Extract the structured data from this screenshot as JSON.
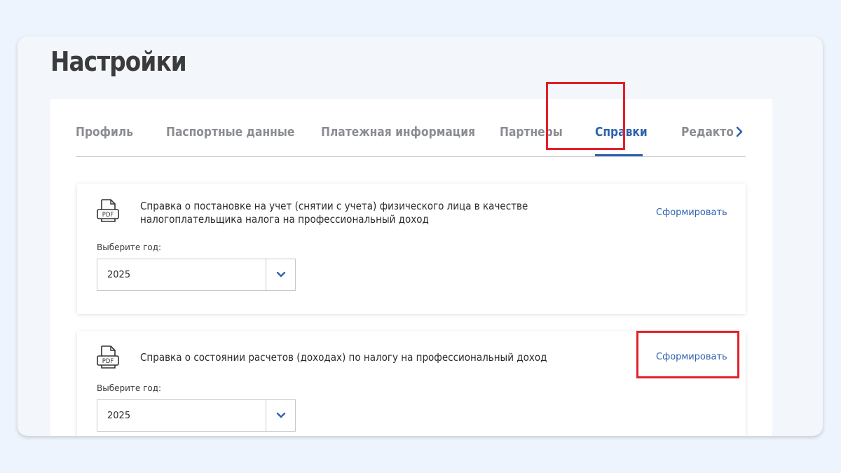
{
  "page": {
    "title": "Настройки"
  },
  "tabs": [
    {
      "label": "Профиль",
      "active": false
    },
    {
      "label": "Паспортные данные",
      "active": false
    },
    {
      "label": "Платежная информация",
      "active": false
    },
    {
      "label": "Партнеры",
      "active": false
    },
    {
      "label": "Справки",
      "active": true
    },
    {
      "label": "Редакто",
      "active": false
    }
  ],
  "cards": [
    {
      "title": "Справка о постановке на учет (снятии с учета) физического лица в качестве налогоплательщика налога на профессиональный доход",
      "action": "Сформировать",
      "year_label": "Выберите год:",
      "year_value": "2025",
      "icon": "pdf-file-icon"
    },
    {
      "title": "Справка о состоянии расчетов (доходах) по налогу на профессиональный доход",
      "action": "Сформировать",
      "year_label": "Выберите год:",
      "year_value": "2025",
      "icon": "pdf-file-icon"
    }
  ],
  "icons": {
    "pdf_text": "PDF"
  },
  "colors": {
    "accent": "#2d62b0",
    "highlight": "#e41e2b",
    "background": "#eef4fd"
  }
}
